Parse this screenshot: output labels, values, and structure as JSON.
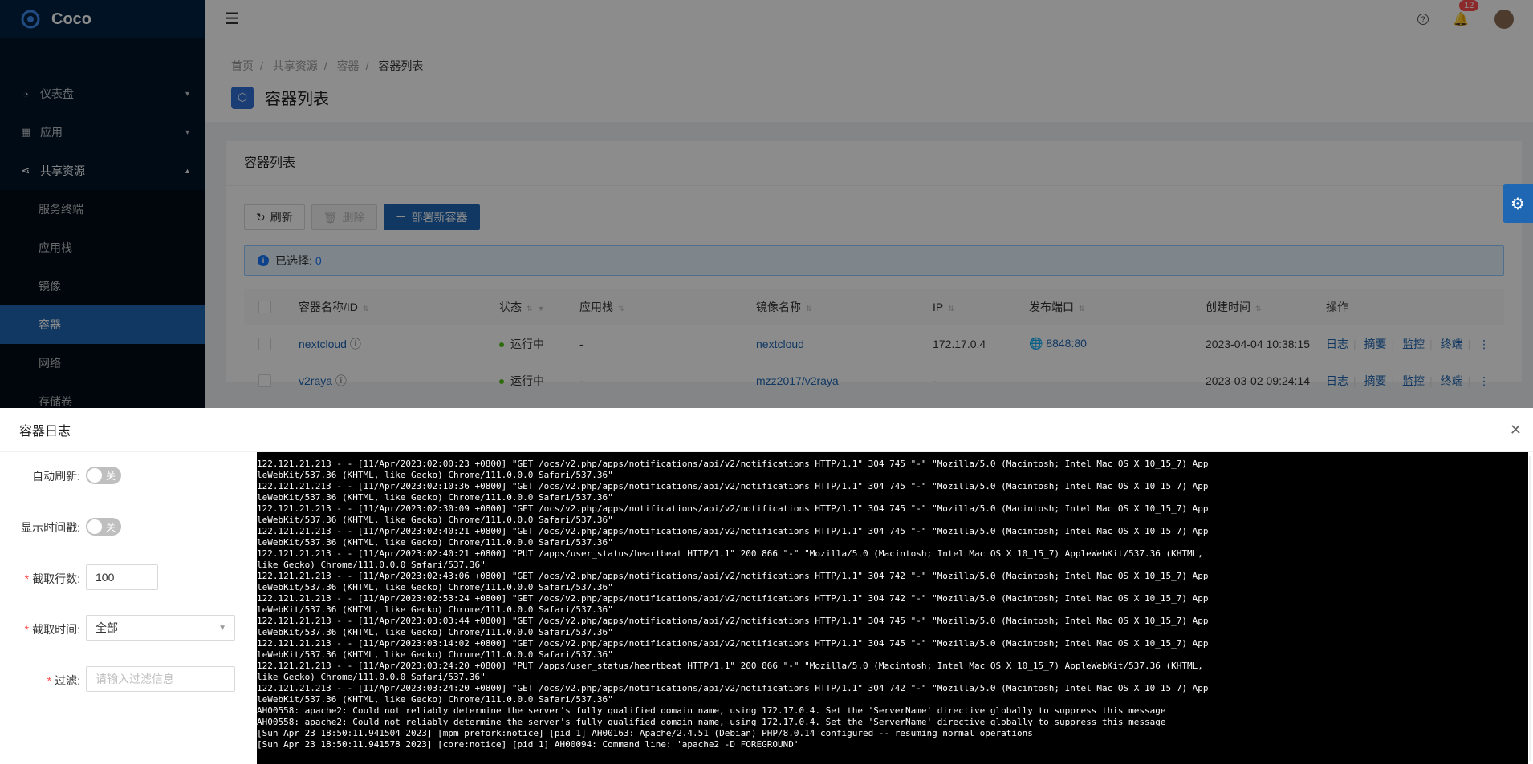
{
  "app": {
    "name": "Coco"
  },
  "sidebar": {
    "items": [
      {
        "label": "仪表盘",
        "icon": "dashboard-icon"
      },
      {
        "label": "应用",
        "icon": "apps-icon"
      },
      {
        "label": "共享资源",
        "icon": "share-icon"
      }
    ],
    "sub_items": [
      {
        "label": "服务终端"
      },
      {
        "label": "应用栈"
      },
      {
        "label": "镜像"
      },
      {
        "label": "容器"
      },
      {
        "label": "网络"
      },
      {
        "label": "存储卷"
      }
    ]
  },
  "header": {
    "notification_count": "12"
  },
  "breadcrumb": [
    "首页",
    "共享资源",
    "容器",
    "容器列表"
  ],
  "page_title": "容器列表",
  "card": {
    "title": "容器列表",
    "refresh": "刷新",
    "delete": "删除",
    "deploy": "部署新容器",
    "selected_label": "已选择:",
    "selected_count": "0"
  },
  "table": {
    "columns": [
      "容器名称/ID",
      "状态",
      "应用栈",
      "镜像名称",
      "IP",
      "发布端口",
      "创建时间",
      "操作"
    ],
    "rows": [
      {
        "name": "nextcloud",
        "status": "运行中",
        "stack": "-",
        "image": "nextcloud",
        "ip": "172.17.0.4",
        "port": "8848:80",
        "created": "2023-04-04 10:38:15"
      },
      {
        "name": "v2raya",
        "status": "运行中",
        "stack": "-",
        "image": "mzz2017/v2raya",
        "ip": "-",
        "port": "",
        "created": "2023-03-02 09:24:14"
      }
    ],
    "actions": [
      "日志",
      "摘要",
      "监控",
      "终端"
    ]
  },
  "drawer": {
    "title": "容器日志",
    "auto_refresh_label": "自动刷新:",
    "auto_refresh_value": "关",
    "timestamp_label": "显示时间戳:",
    "timestamp_value": "关",
    "lines_label": "截取行数:",
    "lines_value": "100",
    "time_label": "截取时间:",
    "time_value": "全部",
    "filter_label": "过滤:",
    "filter_placeholder": "请输入过滤信息"
  },
  "log_lines": [
    "122.121.21.213 - - [11/Apr/2023:02:00:23 +0800] \"GET /ocs/v2.php/apps/notifications/api/v2/notifications HTTP/1.1\" 304 745 \"-\" \"Mozilla/5.0 (Macintosh; Intel Mac OS X 10_15_7) App",
    "leWebKit/537.36 (KHTML, like Gecko) Chrome/111.0.0.0 Safari/537.36\"",
    "122.121.21.213 - - [11/Apr/2023:02:10:36 +0800] \"GET /ocs/v2.php/apps/notifications/api/v2/notifications HTTP/1.1\" 304 745 \"-\" \"Mozilla/5.0 (Macintosh; Intel Mac OS X 10_15_7) App",
    "leWebKit/537.36 (KHTML, like Gecko) Chrome/111.0.0.0 Safari/537.36\"",
    "122.121.21.213 - - [11/Apr/2023:02:30:09 +0800] \"GET /ocs/v2.php/apps/notifications/api/v2/notifications HTTP/1.1\" 304 745 \"-\" \"Mozilla/5.0 (Macintosh; Intel Mac OS X 10_15_7) App",
    "leWebKit/537.36 (KHTML, like Gecko) Chrome/111.0.0.0 Safari/537.36\"",
    "122.121.21.213 - - [11/Apr/2023:02:40:21 +0800] \"GET /ocs/v2.php/apps/notifications/api/v2/notifications HTTP/1.1\" 304 745 \"-\" \"Mozilla/5.0 (Macintosh; Intel Mac OS X 10_15_7) App",
    "leWebKit/537.36 (KHTML, like Gecko) Chrome/111.0.0.0 Safari/537.36\"",
    "122.121.21.213 - - [11/Apr/2023:02:40:21 +0800] \"PUT /apps/user_status/heartbeat HTTP/1.1\" 200 866 \"-\" \"Mozilla/5.0 (Macintosh; Intel Mac OS X 10_15_7) AppleWebKit/537.36 (KHTML,",
    "like Gecko) Chrome/111.0.0.0 Safari/537.36\"",
    "122.121.21.213 - - [11/Apr/2023:02:43:06 +0800] \"GET /ocs/v2.php/apps/notifications/api/v2/notifications HTTP/1.1\" 304 742 \"-\" \"Mozilla/5.0 (Macintosh; Intel Mac OS X 10_15_7) App",
    "leWebKit/537.36 (KHTML, like Gecko) Chrome/111.0.0.0 Safari/537.36\"",
    "122.121.21.213 - - [11/Apr/2023:02:53:24 +0800] \"GET /ocs/v2.php/apps/notifications/api/v2/notifications HTTP/1.1\" 304 742 \"-\" \"Mozilla/5.0 (Macintosh; Intel Mac OS X 10_15_7) App",
    "leWebKit/537.36 (KHTML, like Gecko) Chrome/111.0.0.0 Safari/537.36\"",
    "122.121.21.213 - - [11/Apr/2023:03:03:44 +0800] \"GET /ocs/v2.php/apps/notifications/api/v2/notifications HTTP/1.1\" 304 745 \"-\" \"Mozilla/5.0 (Macintosh; Intel Mac OS X 10_15_7) App",
    "leWebKit/537.36 (KHTML, like Gecko) Chrome/111.0.0.0 Safari/537.36\"",
    "122.121.21.213 - - [11/Apr/2023:03:14:02 +0800] \"GET /ocs/v2.php/apps/notifications/api/v2/notifications HTTP/1.1\" 304 745 \"-\" \"Mozilla/5.0 (Macintosh; Intel Mac OS X 10_15_7) App",
    "leWebKit/537.36 (KHTML, like Gecko) Chrome/111.0.0.0 Safari/537.36\"",
    "122.121.21.213 - - [11/Apr/2023:03:24:20 +0800] \"PUT /apps/user_status/heartbeat HTTP/1.1\" 200 866 \"-\" \"Mozilla/5.0 (Macintosh; Intel Mac OS X 10_15_7) AppleWebKit/537.36 (KHTML,",
    "like Gecko) Chrome/111.0.0.0 Safari/537.36\"",
    "122.121.21.213 - - [11/Apr/2023:03:24:20 +0800] \"GET /ocs/v2.php/apps/notifications/api/v2/notifications HTTP/1.1\" 304 742 \"-\" \"Mozilla/5.0 (Macintosh; Intel Mac OS X 10_15_7) App",
    "leWebKit/537.36 (KHTML, like Gecko) Chrome/111.0.0.0 Safari/537.36\"",
    "AH00558: apache2: Could not reliably determine the server's fully qualified domain name, using 172.17.0.4. Set the 'ServerName' directive globally to suppress this message",
    "AH00558: apache2: Could not reliably determine the server's fully qualified domain name, using 172.17.0.4. Set the 'ServerName' directive globally to suppress this message",
    "[Sun Apr 23 18:50:11.941504 2023] [mpm_prefork:notice] [pid 1] AH00163: Apache/2.4.51 (Debian) PHP/8.0.14 configured -- resuming normal operations",
    "[Sun Apr 23 18:50:11.941578 2023] [core:notice] [pid 1] AH00094: Command line: 'apache2 -D FOREGROUND'"
  ]
}
